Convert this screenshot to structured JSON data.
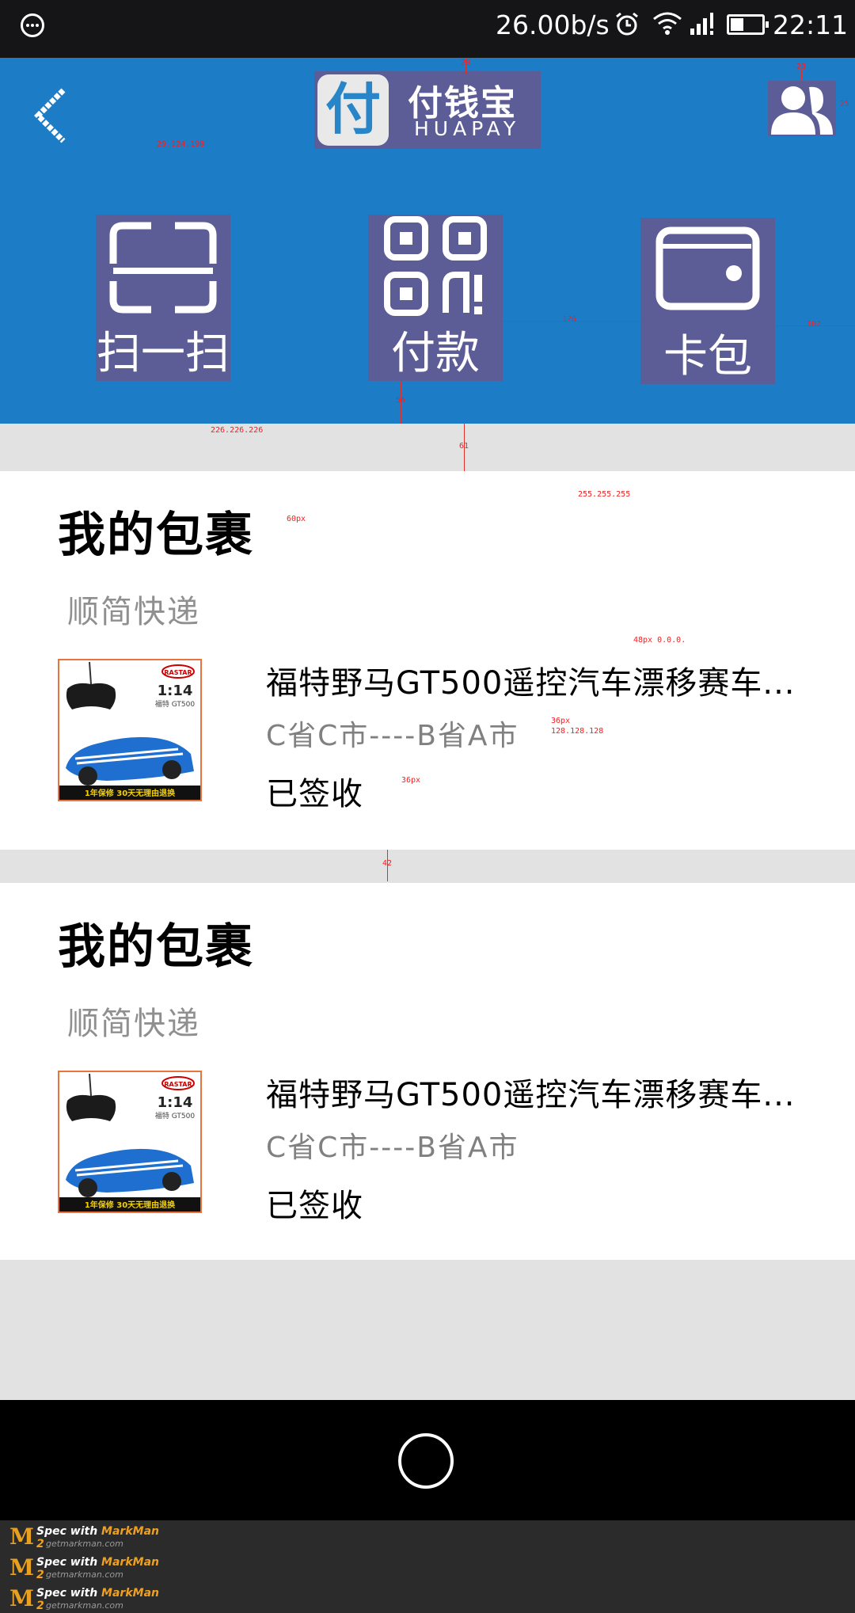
{
  "status_bar": {
    "net_speed": "26.00b/s",
    "time": "22:11"
  },
  "header": {
    "logo_mark": "付",
    "logo_name": "付钱宝",
    "logo_sub": "HUAPAY",
    "actions": [
      {
        "label": "扫一扫",
        "icon": "scan-icon"
      },
      {
        "label": "付款",
        "icon": "qr-code-icon"
      },
      {
        "label": "卡包",
        "icon": "wallet-icon"
      }
    ]
  },
  "parcels": [
    {
      "title": "我的包裹",
      "courier": "顺简快递",
      "product_name": "福特野马GT500遥控汽车漂移赛车...",
      "route": "C省C市----B省A市",
      "status": "已签收",
      "thumb": {
        "brand": "RASTAR",
        "scale": "1:14",
        "model": "福特 GT500",
        "badge": "1年保修 30天无理由退换"
      }
    },
    {
      "title": "我的包裹",
      "courier": "顺简快递",
      "product_name": "福特野马GT500遥控汽车漂移赛车...",
      "route": "C省C市----B省A市",
      "status": "已签收",
      "thumb": {
        "brand": "RASTAR",
        "scale": "1:14",
        "model": "福特 GT500",
        "badge": "1年保修 30天无理由退换"
      }
    }
  ],
  "annotations": {
    "header_color": "29.124.198",
    "gap_color": "226.226.226",
    "card_color": "255.255.255",
    "title_size": "60px",
    "name_spec": "48px  0.0.0.",
    "route_size": "36px",
    "route_color": "128.128.128",
    "status_size": "36px",
    "logo_top": "20",
    "icon_top": "28",
    "icon_right": "25",
    "action_gap": "176",
    "action_right": "102",
    "action_bottom": "56",
    "gap_top": "61",
    "gap_between": "42"
  },
  "footer": {
    "lines": [
      {
        "brand": "MarkMan 2",
        "prefix": "Spec with",
        "site": "getmarkman.com"
      },
      {
        "brand": "MarkMan 2",
        "prefix": "Spec with",
        "site": "getmarkman.com"
      },
      {
        "brand": "MarkMan 2",
        "prefix": "Spec with",
        "site": "getmarkman.com"
      }
    ]
  },
  "colors": {
    "header_bg": "#1d7cc6",
    "page_bg": "#e2e2e2",
    "card_bg": "#ffffff",
    "route_text": "#808080",
    "spec_box": "#5c5c96"
  }
}
